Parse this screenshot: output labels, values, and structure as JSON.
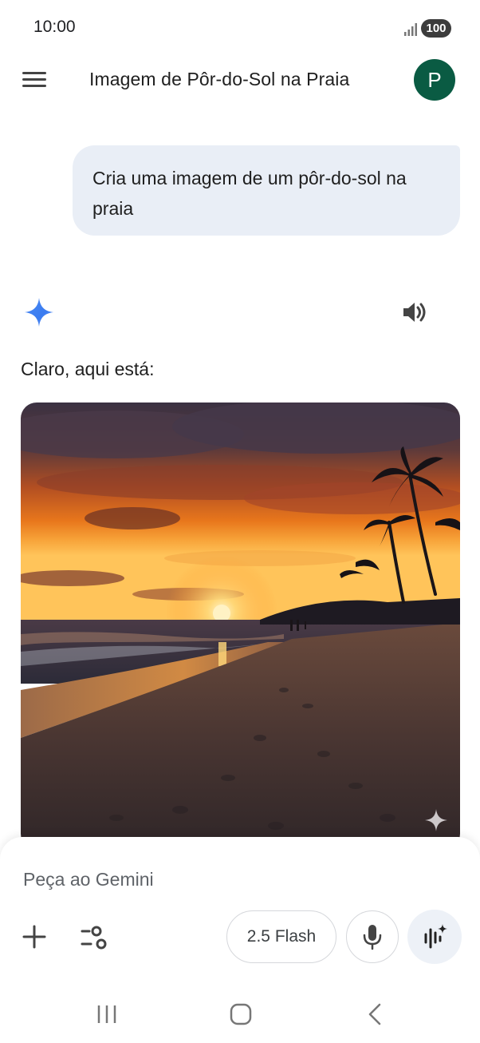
{
  "status_bar": {
    "time": "10:00",
    "battery": "100",
    "signal_icon": "signal-bars-icon"
  },
  "header": {
    "title": "Imagem de Pôr-do-Sol na Praia",
    "avatar_letter": "P",
    "avatar_color": "#0a5b43",
    "menu_icon": "hamburger-menu-icon"
  },
  "conversation": {
    "user_message": "Cria uma imagem de um pôr-do-sol na praia",
    "assistant_icon": "gemini-spark-icon",
    "read_aloud_icon": "speaker-icon",
    "assistant_reply": "Claro, aqui está:",
    "generated_image": {
      "subject": "sunset-beach-image",
      "watermark_icon": "sparkle-icon"
    }
  },
  "composer": {
    "placeholder": "Peça ao Gemini",
    "add_icon": "plus-icon",
    "tools_icon": "tools-sliders-icon",
    "model_label": "2.5 Flash",
    "mic_icon": "microphone-icon",
    "live_icon": "live-waveform-icon"
  },
  "navigation_bar": {
    "recents_icon": "recents-icon",
    "home_icon": "home-icon",
    "back_icon": "back-icon"
  },
  "colors": {
    "user_bubble": "#e9eef6",
    "gemini_blue": "#4a8af4",
    "live_button_bg": "#edf1f7"
  }
}
